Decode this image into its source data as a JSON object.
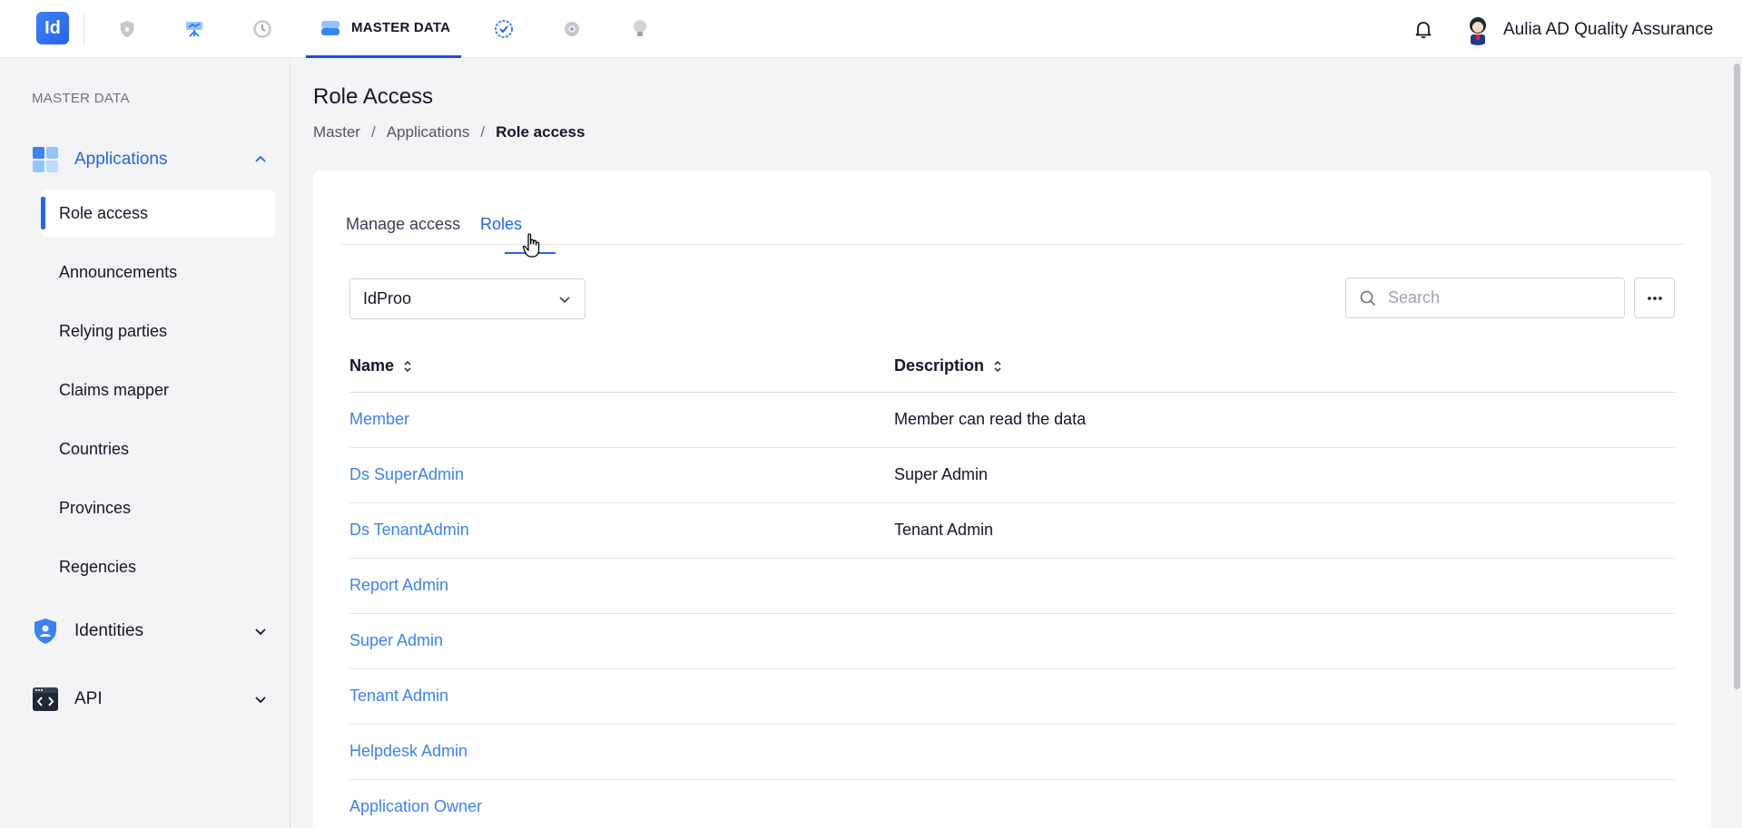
{
  "topbar": {
    "logo_text": "Id",
    "active_nav_label": "MASTER DATA",
    "user_name": "Aulia AD Quality Assurance",
    "nav_icons": [
      "shield-icon",
      "dashboard-icon",
      "history-icon",
      "master-data-icon",
      "check-badge-icon",
      "settings-icon",
      "bulb-icon"
    ],
    "accent": "#2563eb"
  },
  "sidebar": {
    "section_label": "MASTER DATA",
    "groups": [
      {
        "label": "Applications",
        "expanded": true
      },
      {
        "label": "Identities",
        "expanded": false
      },
      {
        "label": "API",
        "expanded": false
      }
    ],
    "items": [
      {
        "label": "Role access",
        "active": true
      },
      {
        "label": "Announcements"
      },
      {
        "label": "Relying parties"
      },
      {
        "label": "Claims mapper"
      },
      {
        "label": "Countries"
      },
      {
        "label": "Provinces"
      },
      {
        "label": "Regencies"
      }
    ]
  },
  "main": {
    "title": "Role Access",
    "breadcrumb": [
      "Master",
      "Applications",
      "Role access"
    ],
    "tabs": [
      {
        "label": "Manage access"
      },
      {
        "label": "Roles",
        "active": true
      }
    ],
    "app_select": {
      "value": "IdProo"
    },
    "search": {
      "placeholder": "Search",
      "value": ""
    },
    "table": {
      "headers": [
        "Name",
        "Description"
      ],
      "rows": [
        {
          "name": "Member",
          "description": "Member can read the data"
        },
        {
          "name": "Ds SuperAdmin",
          "description": "Super Admin"
        },
        {
          "name": "Ds TenantAdmin",
          "description": "Tenant Admin"
        },
        {
          "name": "Report Admin",
          "description": ""
        },
        {
          "name": "Super Admin",
          "description": ""
        },
        {
          "name": "Tenant Admin",
          "description": ""
        },
        {
          "name": "Helpdesk Admin",
          "description": ""
        },
        {
          "name": "Application Owner",
          "description": ""
        }
      ]
    }
  }
}
